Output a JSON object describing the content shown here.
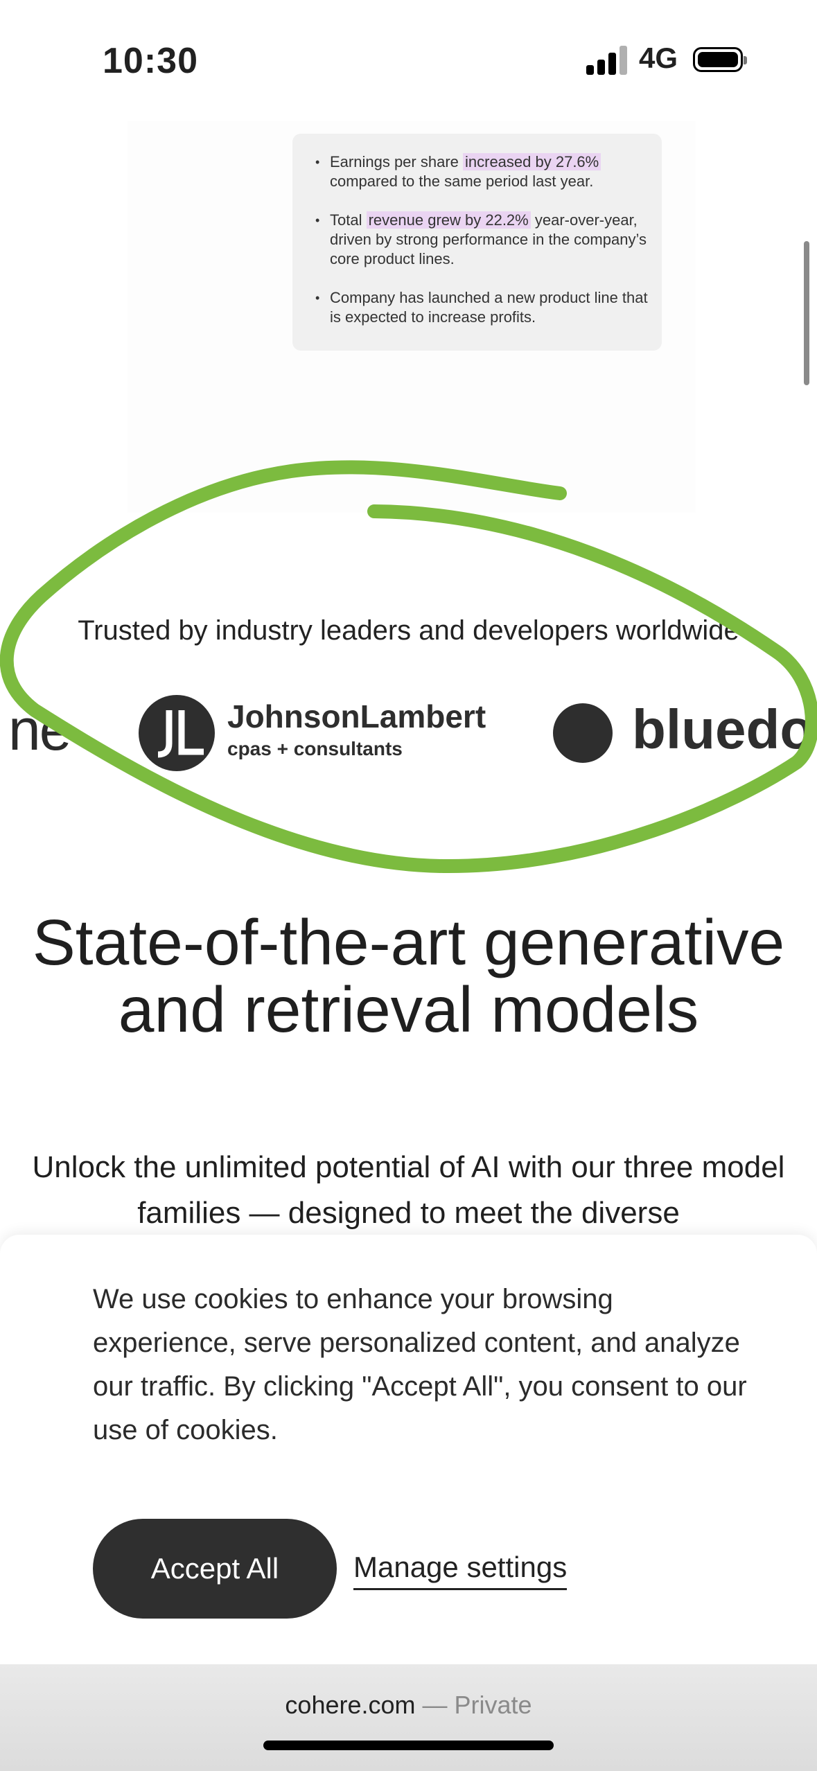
{
  "status_bar": {
    "time": "10:30",
    "network": "4G"
  },
  "summary_card": {
    "bullets": [
      {
        "before": "Earnings per share ",
        "highlight": "increased by 27.6%",
        "after": " compared to the same period last year."
      },
      {
        "before": "Total ",
        "highlight": "revenue grew by 22.2%",
        "after": " year-over-year, driven by strong performance in the company’s core product lines."
      },
      {
        "before": "Company has launched a new product line that is expected to increase profits.",
        "highlight": "",
        "after": ""
      }
    ]
  },
  "trusted": {
    "heading": "Trusted by industry leaders and developers worldwide",
    "logos": {
      "partial_left": "ne",
      "johnson_lambert_name": "JohnsonLambert",
      "johnson_lambert_sub": "cpas + consultants",
      "partial_right": "bluedo"
    }
  },
  "hero": {
    "headline": "State-of-the-art generative and retrieval models",
    "subtext": "Unlock the unlimited potential of AI with our three model families — designed to meet the diverse"
  },
  "cookie_banner": {
    "message": "We use cookies to enhance your browsing experience, serve personalized content, and analyze our traffic. By clicking \"Accept All\", you consent to our use of cookies.",
    "accept_label": "Accept All",
    "manage_label": "Manage settings"
  },
  "browser": {
    "domain": "cohere.com",
    "mode": " — Private"
  },
  "colors": {
    "annotation_green": "#7cbb3f",
    "highlight_purple": "#ead4f2",
    "button_dark": "#2f2f2f"
  }
}
